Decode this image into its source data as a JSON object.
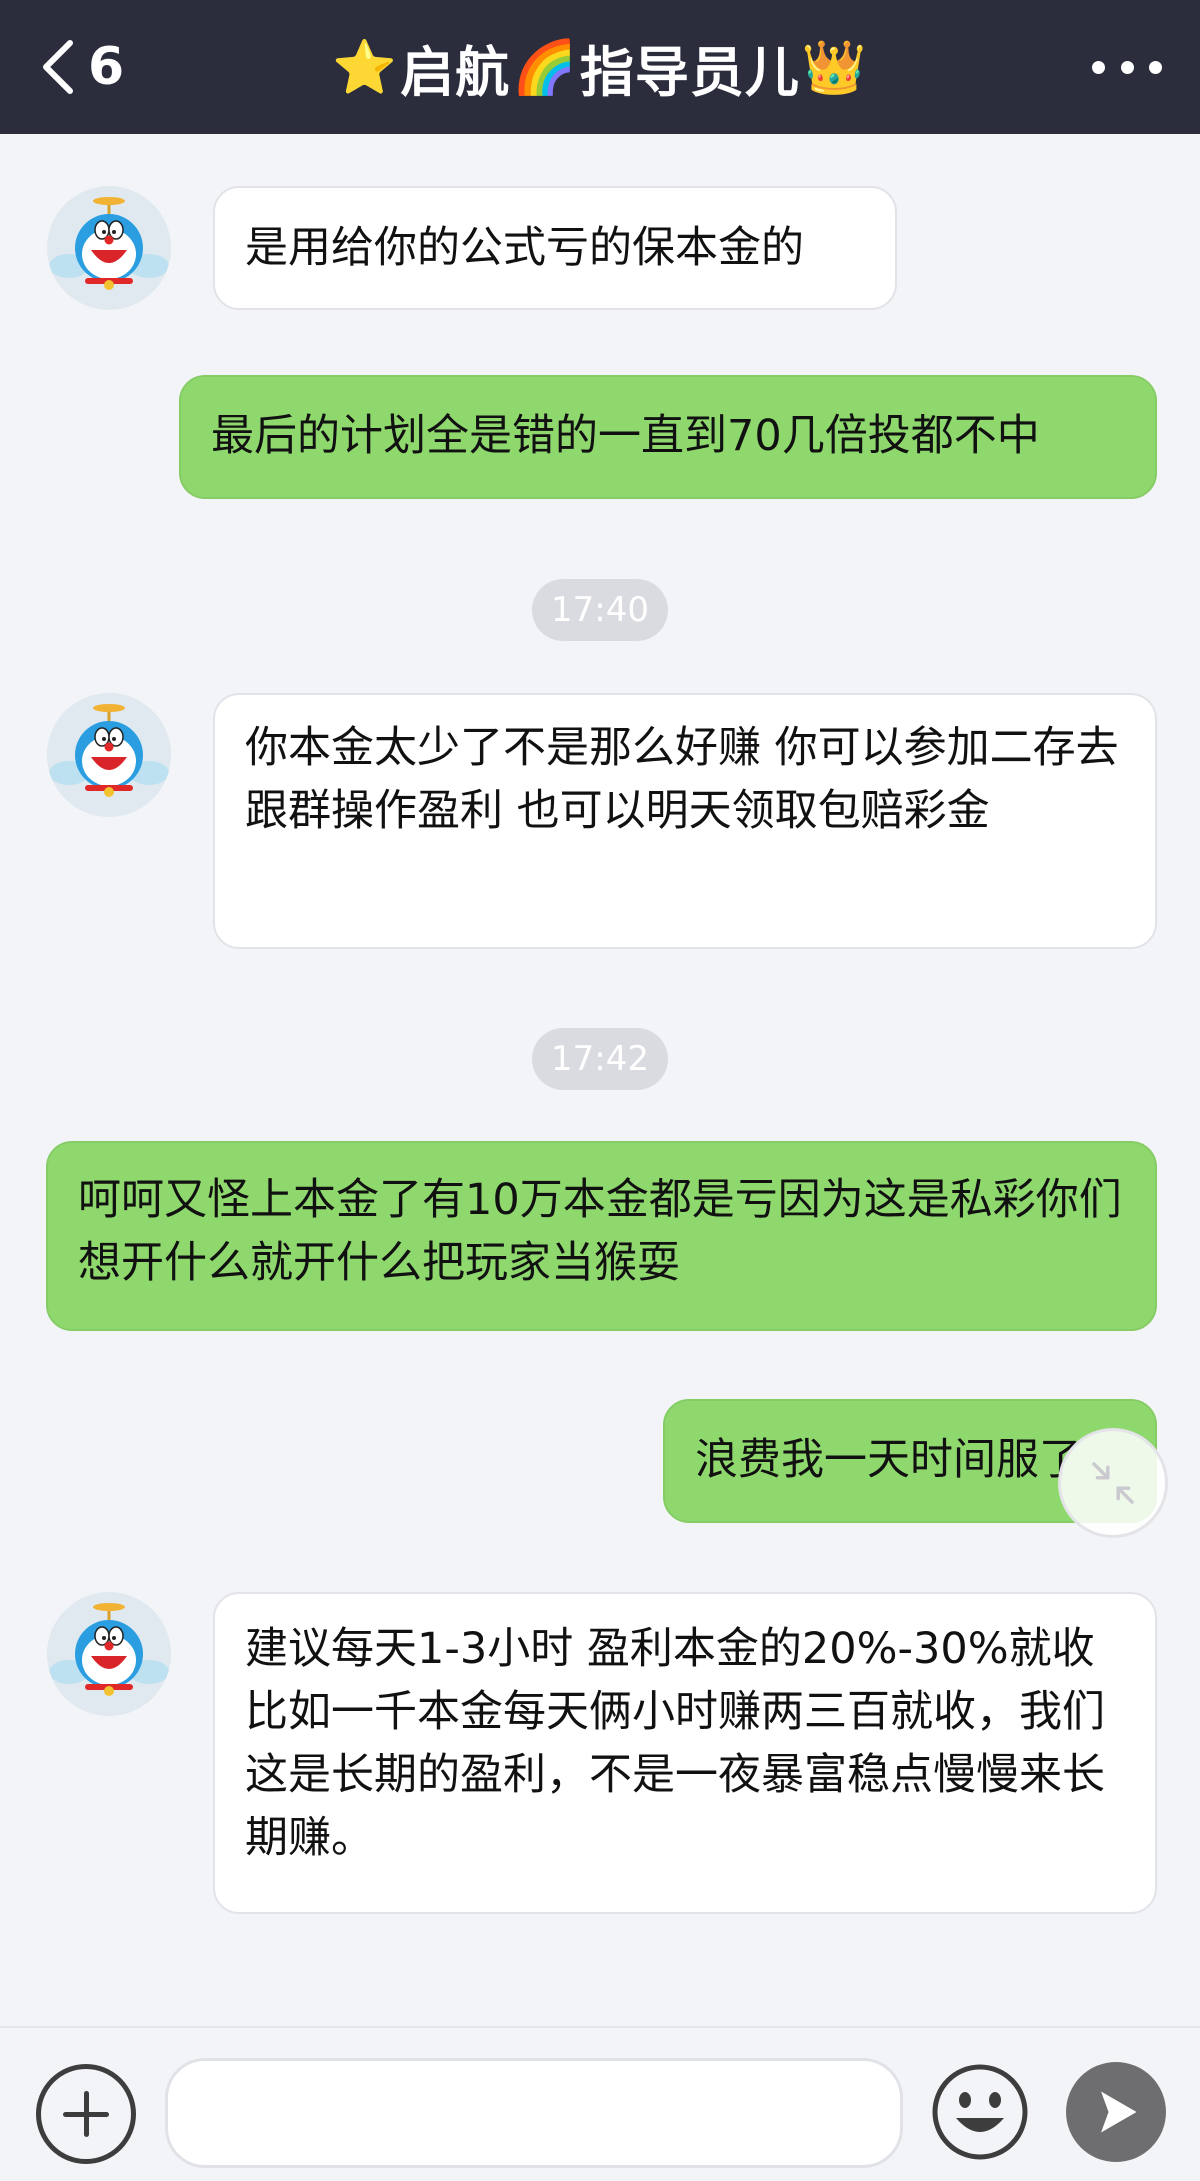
{
  "header": {
    "back_count": "6",
    "title_prefix_emoji": "⭐",
    "title_part1": "启航",
    "title_mid_emoji": "🌈",
    "title_part2": "指导员儿",
    "title_suffix_emoji": "👑"
  },
  "messages": [
    {
      "side": "left",
      "text": "是用给你的公式亏的保本金的"
    },
    {
      "side": "right",
      "text": "最后的计划全是错的一直到70几倍投都不中"
    },
    {
      "type": "time",
      "text": "17:40"
    },
    {
      "side": "left",
      "text": "你本金太少了不是那么好赚 你可以参加二存去跟群操作盈利 也可以明天领取包赔彩金"
    },
    {
      "type": "time",
      "text": "17:42"
    },
    {
      "side": "right",
      "text": "呵呵又怪上本金了有10万本金都是亏因为这是私彩你们想开什么就开什么把玩家当猴耍"
    },
    {
      "side": "right",
      "text": "浪费我一天时间服了"
    },
    {
      "side": "left",
      "text": "建议每天1-3小时 盈利本金的20%-30%就收 比如一千本金每天俩小时赚两三百就收，我们这是长期的盈利，不是一夜暴富稳点慢慢来长期赚。"
    }
  ],
  "input": {
    "value": "",
    "placeholder": ""
  },
  "colors": {
    "header_bg": "#2b2d3d",
    "outgoing_bubble": "#8fd86e",
    "incoming_bubble": "#ffffff",
    "chat_bg": "#f3f4f8",
    "send_button": "#6e6e70"
  },
  "icons": {
    "back": "chevron-left-icon",
    "more": "more-dots-icon",
    "avatar": "doraemon-avatar",
    "collapse": "collapse-arrows-icon",
    "add": "plus-circle-icon",
    "emoji": "smiley-face-icon",
    "send": "send-arrow-icon"
  }
}
